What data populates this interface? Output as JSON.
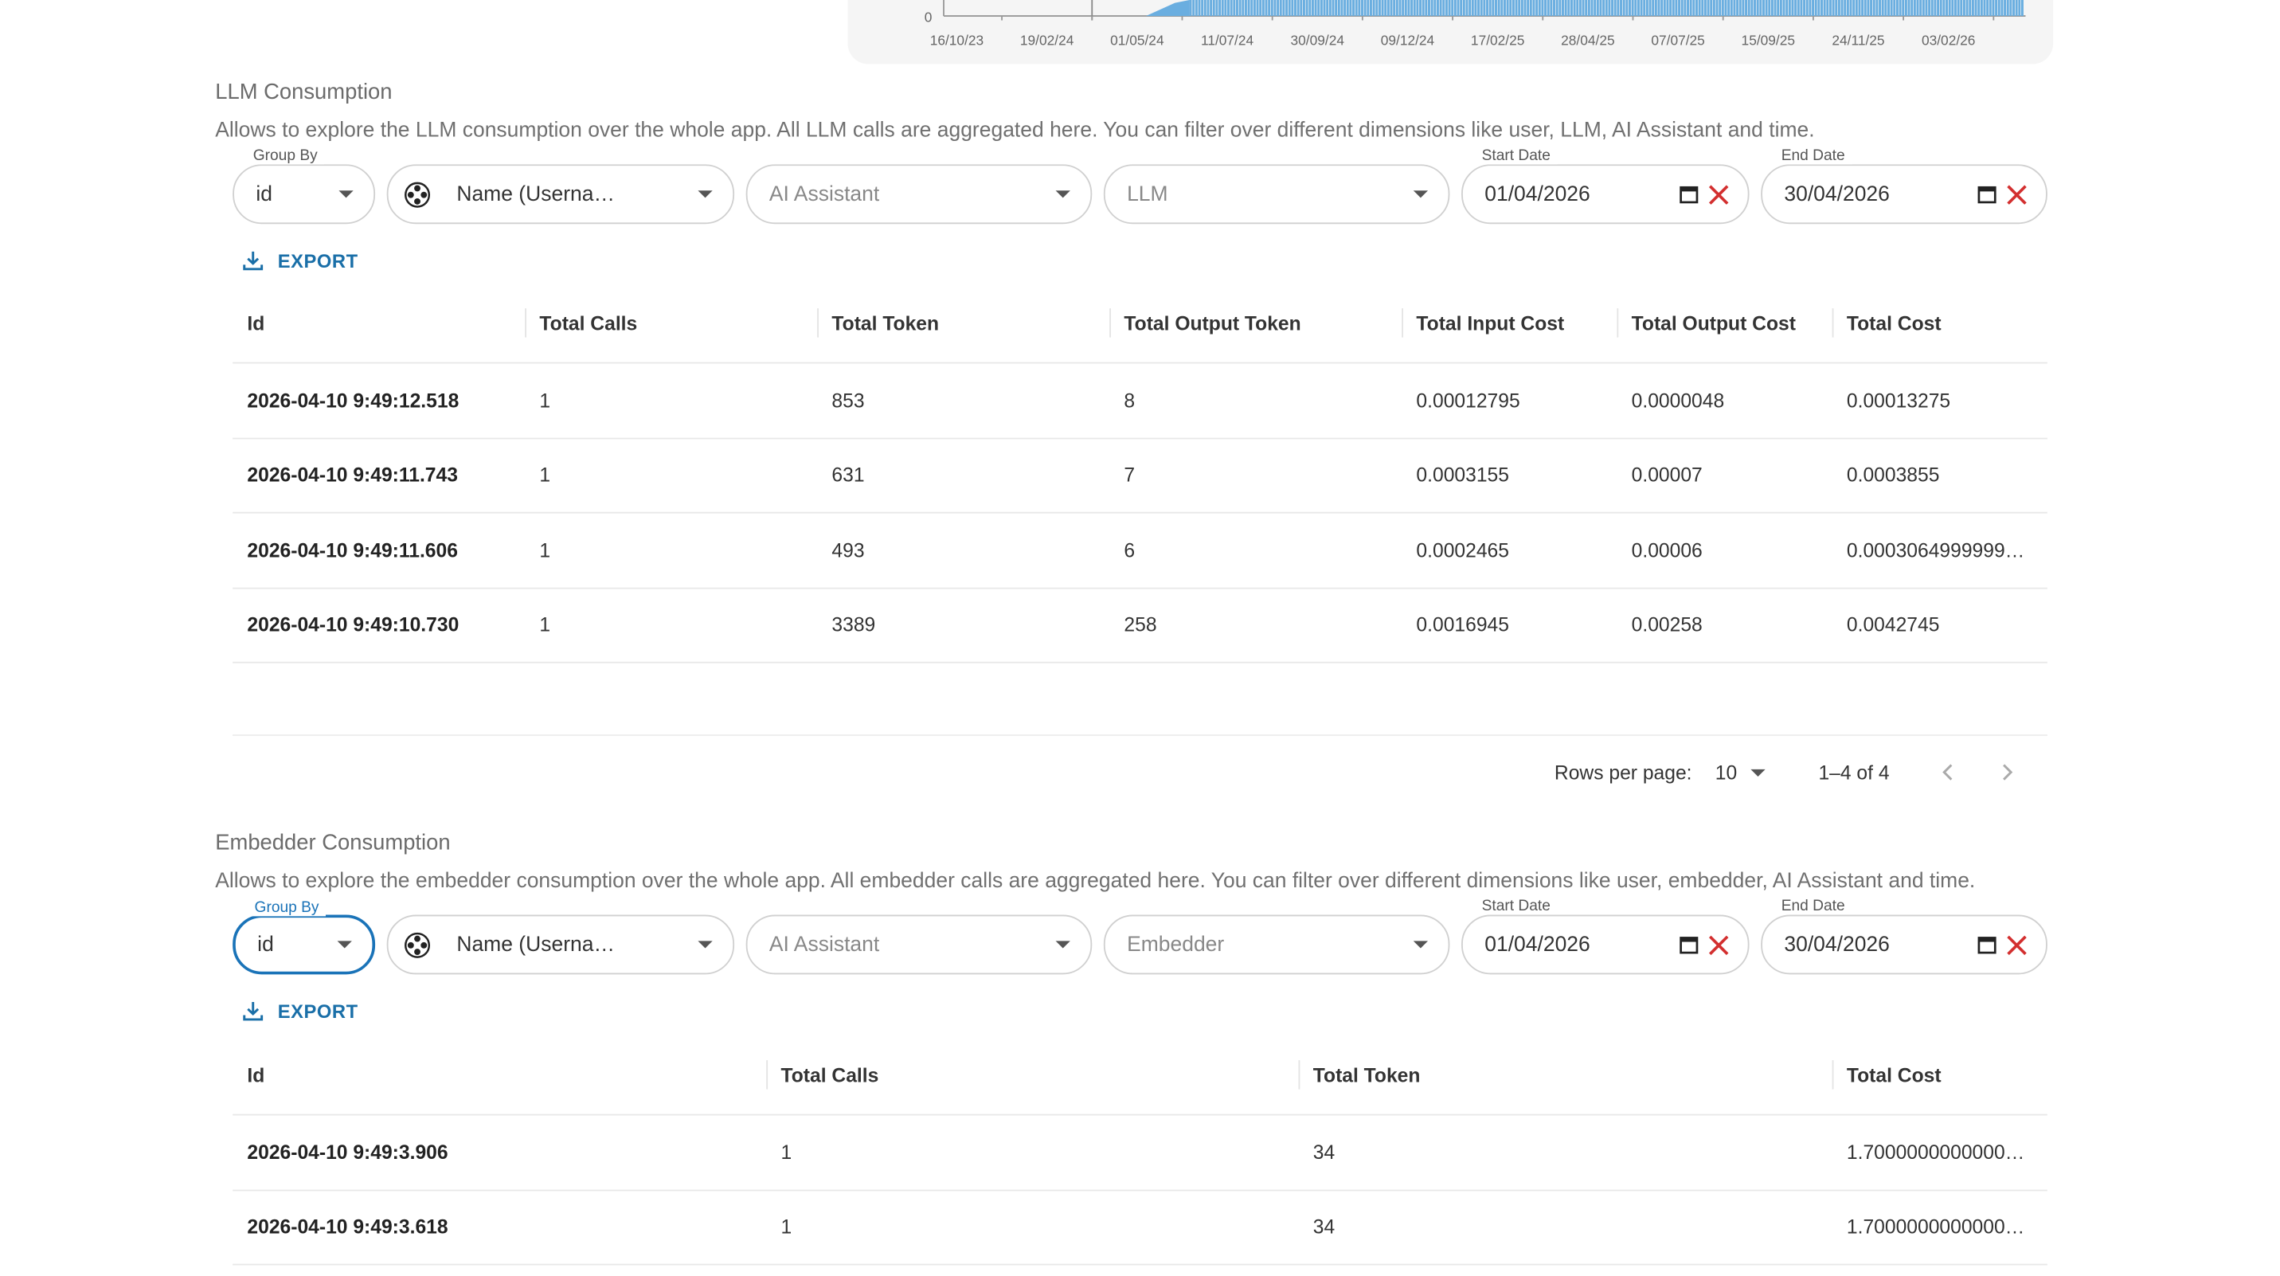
{
  "chart": {
    "y_zero_label": "0",
    "x_ticks": [
      "16/10/23",
      "19/02/24",
      "01/05/24",
      "11/07/24",
      "30/09/24",
      "09/12/24",
      "17/02/25",
      "28/04/25",
      "07/07/25",
      "15/09/25",
      "24/11/25",
      "03/02/26"
    ],
    "bar_color": "#6aaee0"
  },
  "llm": {
    "title": "LLM Consumption",
    "description": "Allows to explore the LLM consumption over the whole app. All LLM calls are aggregated here. You can filter over different dimensions like user, LLM, AI Assistant and time.",
    "filters": {
      "group_by": {
        "label": "Group By",
        "value": "id"
      },
      "user": {
        "value": "Name (Userna…"
      },
      "assistant": {
        "placeholder": "AI Assistant"
      },
      "model": {
        "placeholder": "LLM"
      },
      "start_date": {
        "label": "Start Date",
        "value": "01/04/2026"
      },
      "end_date": {
        "label": "End Date",
        "value": "30/04/2026"
      }
    },
    "export_label": "EXPORT",
    "columns": [
      "Id",
      "Total Calls",
      "Total Token",
      "Total Output Token",
      "Total Input Cost",
      "Total Output Cost",
      "Total Cost"
    ],
    "rows": [
      [
        "2026-04-10 9:49:12.518",
        "1",
        "853",
        "8",
        "0.00012795",
        "0.0000048",
        "0.00013275"
      ],
      [
        "2026-04-10 9:49:11.743",
        "1",
        "631",
        "7",
        "0.0003155",
        "0.00007",
        "0.0003855"
      ],
      [
        "2026-04-10 9:49:11.606",
        "1",
        "493",
        "6",
        "0.0002465",
        "0.00006",
        "0.0003064999999…"
      ],
      [
        "2026-04-10 9:49:10.730",
        "1",
        "3389",
        "258",
        "0.0016945",
        "0.00258",
        "0.0042745"
      ]
    ],
    "pagination": {
      "rows_per_page_label": "Rows per page:",
      "rows_per_page": "10",
      "range": "1–4 of 4"
    }
  },
  "embedder": {
    "title": "Embedder Consumption",
    "description": "Allows to explore the embedder consumption over the whole app. All embedder calls are aggregated here. You can filter over different dimensions like user, embedder, AI Assistant and time.",
    "filters": {
      "group_by": {
        "label": "Group By",
        "value": "id"
      },
      "user": {
        "value": "Name (Userna…"
      },
      "assistant": {
        "placeholder": "AI Assistant"
      },
      "model": {
        "placeholder": "Embedder"
      },
      "start_date": {
        "label": "Start Date",
        "value": "01/04/2026"
      },
      "end_date": {
        "label": "End Date",
        "value": "30/04/2026"
      }
    },
    "export_label": "EXPORT",
    "columns": [
      "Id",
      "Total Calls",
      "Total Token",
      "Total Cost"
    ],
    "rows": [
      [
        "2026-04-10 9:49:3.906",
        "1",
        "34",
        "1.7000000000000…"
      ],
      [
        "2026-04-10 9:49:3.618",
        "1",
        "34",
        "1.7000000000000…"
      ]
    ]
  }
}
